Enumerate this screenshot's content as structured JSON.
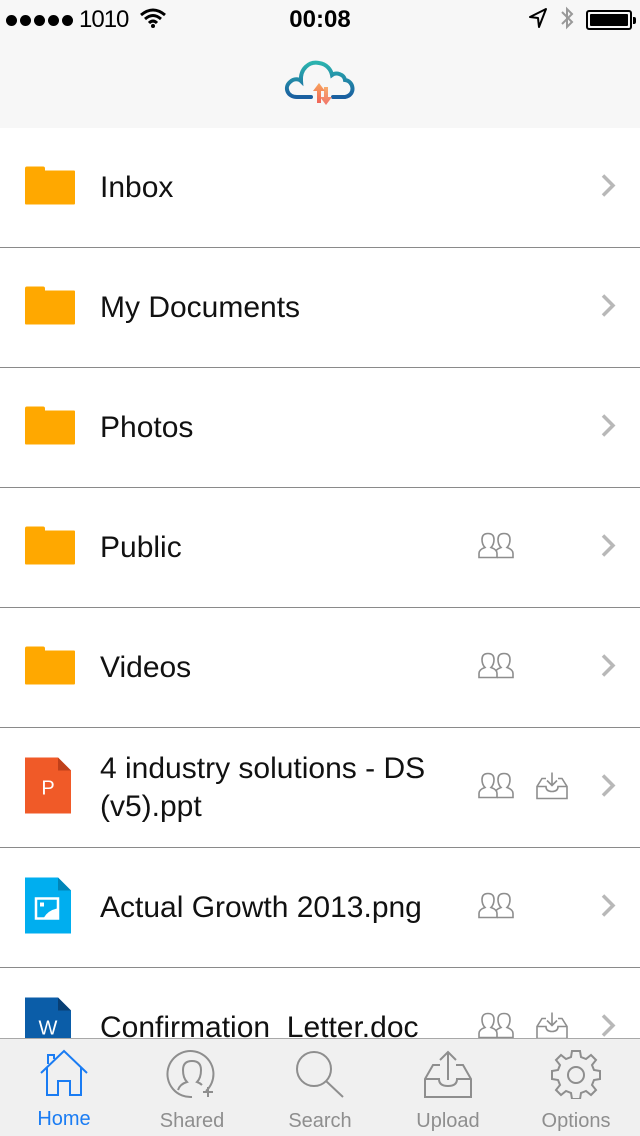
{
  "status_bar": {
    "signal_dots": 5,
    "carrier": "1010",
    "time": "00:08",
    "icons": [
      "wifi-icon",
      "location-arrow-icon",
      "bluetooth-icon",
      "battery-icon"
    ]
  },
  "header": {
    "logo": "cloud-sync-logo-icon"
  },
  "list": {
    "items": [
      {
        "name": "Inbox",
        "type": "folder",
        "shared": false,
        "offline": false
      },
      {
        "name": "My Documents",
        "type": "folder",
        "shared": false,
        "offline": false
      },
      {
        "name": "Photos",
        "type": "folder",
        "shared": false,
        "offline": false
      },
      {
        "name": "Public",
        "type": "folder",
        "shared": true,
        "offline": false
      },
      {
        "name": "Videos",
        "type": "folder",
        "shared": true,
        "offline": false
      },
      {
        "name": "4 industry solutions - DS (v5).ppt",
        "type": "ppt",
        "badge": "P",
        "shared": true,
        "offline": true
      },
      {
        "name": "Actual Growth 2013.png",
        "type": "image",
        "shared": true,
        "offline": false
      },
      {
        "name": "Confirmation_Letter.doc",
        "type": "doc",
        "badge": "W",
        "shared": true,
        "offline": true
      }
    ]
  },
  "tabbar": {
    "tabs": [
      {
        "label": "Home",
        "icon": "home-icon",
        "active": true
      },
      {
        "label": "Shared",
        "icon": "add-user-icon",
        "active": false
      },
      {
        "label": "Search",
        "icon": "search-icon",
        "active": false
      },
      {
        "label": "Upload",
        "icon": "upload-icon",
        "active": false
      },
      {
        "label": "Options",
        "icon": "gear-icon",
        "active": false
      }
    ]
  },
  "colors": {
    "accent": "#1a7cf3",
    "folder": "#ffa800",
    "ppt": "#f05a28",
    "ppt_fold": "#c0401a",
    "image": "#00aeef",
    "image_fold": "#0085b8",
    "doc": "#0b5da8",
    "doc_fold": "#083f74",
    "icon_gray": "#8e8e8e",
    "chevron": "#b8b8b8"
  }
}
